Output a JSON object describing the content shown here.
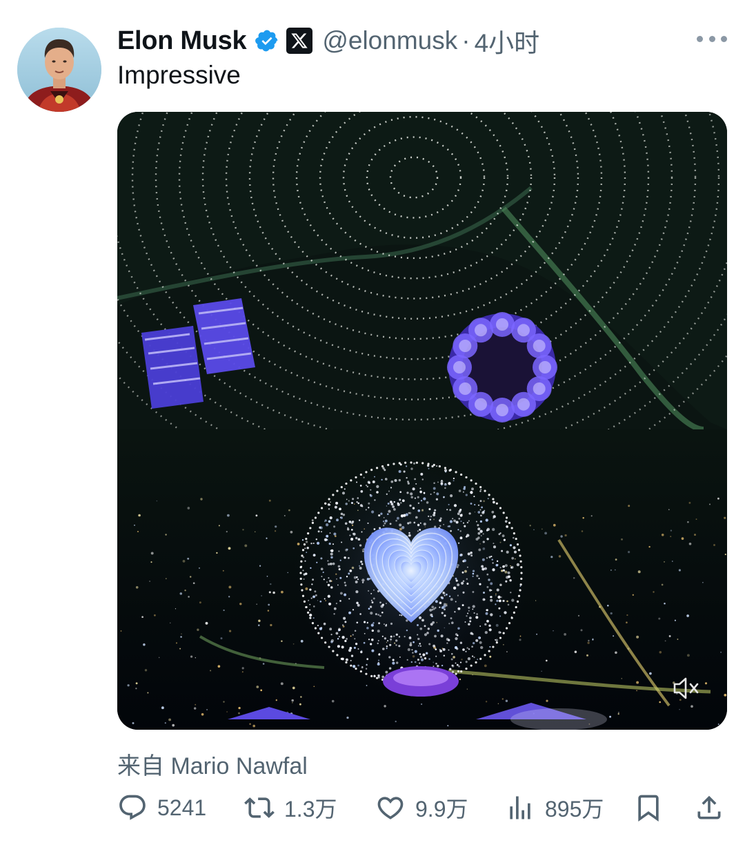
{
  "tweet": {
    "author_name": "Elon Musk",
    "handle": "@elonmusk",
    "separator": "·",
    "time": "4小时",
    "text": "Impressive",
    "source": "来自 Mario Nawfal",
    "verified_color": "#1d9bf0",
    "icons": {
      "verified": "verified-badge-icon",
      "affiliate": "x-logo-icon",
      "more": "more-horizontal-icon",
      "mute": "volume-muted-icon"
    }
  },
  "media": {
    "type": "video",
    "muted": true
  },
  "actions": {
    "replies": {
      "icon": "reply-icon",
      "count": "5241"
    },
    "reposts": {
      "icon": "repost-icon",
      "count": "1.3万"
    },
    "likes": {
      "icon": "heart-icon",
      "count": "9.9万"
    },
    "views": {
      "icon": "views-icon",
      "count": "895万"
    },
    "bookmark": {
      "icon": "bookmark-icon"
    },
    "share": {
      "icon": "share-icon"
    }
  }
}
